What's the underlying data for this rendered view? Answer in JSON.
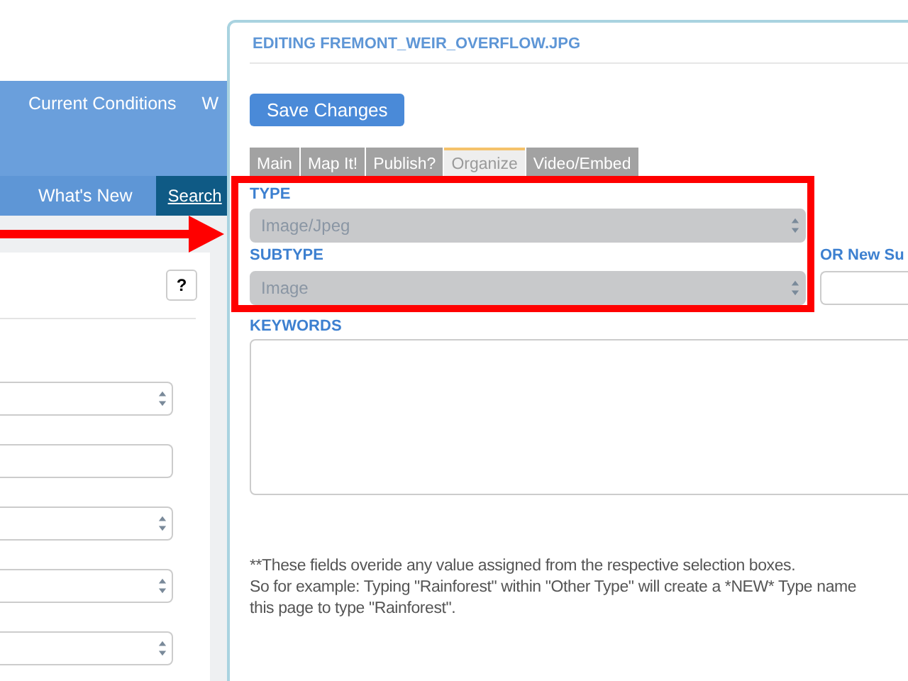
{
  "page": {
    "nav": [
      {
        "label": "Current Conditions"
      },
      {
        "label": "W"
      }
    ],
    "subnav": [
      {
        "label": "What's New",
        "selected": false
      },
      {
        "label": "Search",
        "selected": true
      }
    ],
    "help_button": "?",
    "filters": [
      {
        "kind": "select"
      },
      {
        "kind": "input"
      },
      {
        "kind": "select"
      },
      {
        "kind": "select"
      },
      {
        "kind": "select"
      }
    ]
  },
  "dialog": {
    "title": "EDITING FREMONT_WEIR_OVERFLOW.JPG",
    "save_button": "Save Changes",
    "tabs": [
      {
        "label": "Main",
        "selected": false
      },
      {
        "label": "Map It!",
        "selected": false
      },
      {
        "label": "Publish?",
        "selected": false
      },
      {
        "label": "Organize",
        "selected": true
      },
      {
        "label": "Video/Embed",
        "selected": false
      }
    ],
    "type": {
      "label": "TYPE",
      "value": "Image/Jpeg",
      "disabled": true
    },
    "subtype": {
      "label": "SUBTYPE",
      "value": "Image",
      "disabled": true
    },
    "new_subtype": {
      "label": "OR New Su"
    },
    "keywords": {
      "label": "KEYWORDS"
    },
    "note": [
      "**These fields overide any value assigned from the respective selection boxes.",
      "So for example: Typing \"Rainforest\" within \"Other Type\" will create a *NEW* Type name",
      "this page to type \"Rainforest\"."
    ]
  },
  "annotations": {
    "frame": true,
    "arrow": true
  }
}
